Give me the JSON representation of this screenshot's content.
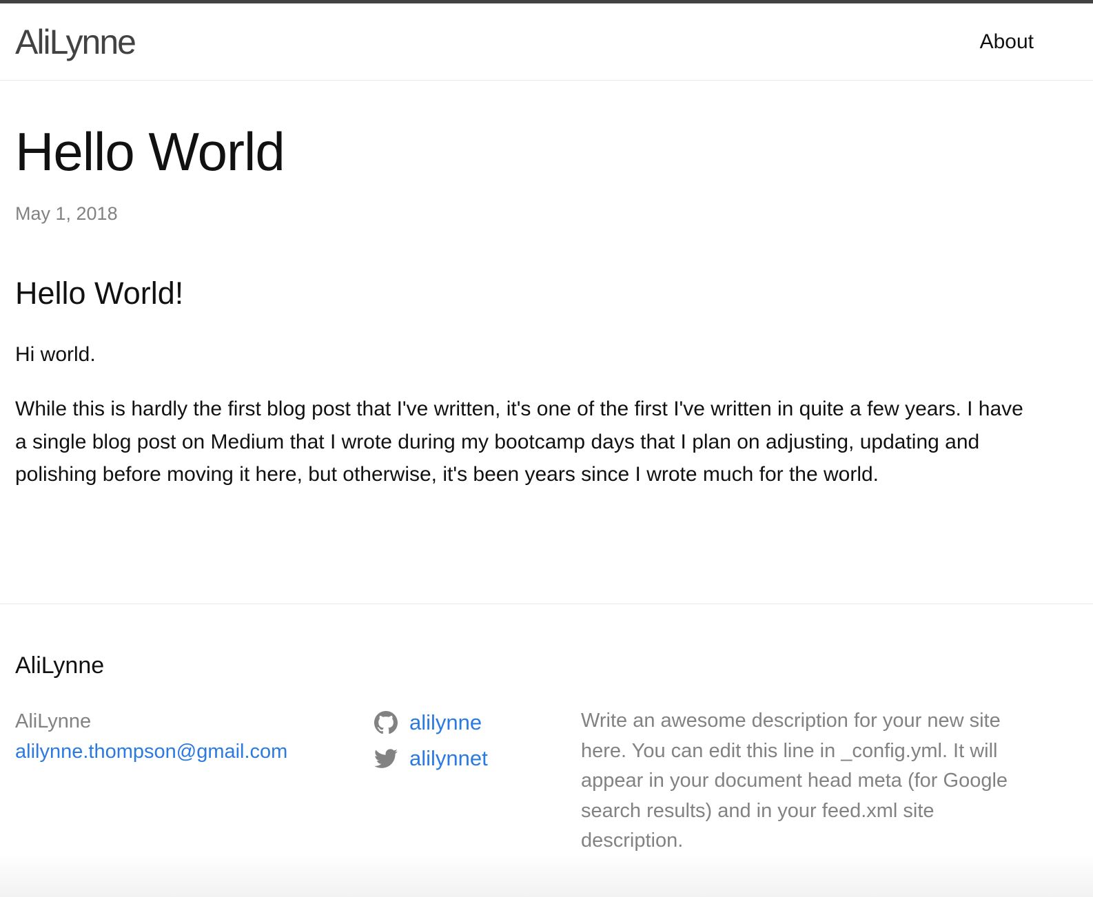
{
  "header": {
    "site_title": "AliLynne",
    "nav": {
      "about": "About"
    }
  },
  "post": {
    "title": "Hello World",
    "date": "May 1, 2018",
    "heading": "Hello World!",
    "paragraphs": [
      "Hi world.",
      "While this is hardly the first blog post that I've written, it's one of the first I've written in quite a few years. I have a single blog post on Medium that I wrote during my bootcamp days that I plan on adjusting, updating and polishing before moving it here, but otherwise, it's been years since I wrote much for the world."
    ]
  },
  "footer": {
    "heading": "AliLynne",
    "name": "AliLynne",
    "email": "alilynne.thompson@gmail.com",
    "social": [
      {
        "icon": "github-icon",
        "label": "alilynne"
      },
      {
        "icon": "twitter-icon",
        "label": "alilynnet"
      }
    ],
    "description": "Write an awesome description for your new site here. You can edit this line in _config.yml. It will appear in your document head meta (for Google search results) and in your feed.xml site description."
  },
  "colors": {
    "accent": "#2a7ae2",
    "muted_text": "#828282",
    "text": "#111111",
    "top_rule": "#424242",
    "divider": "#e8e8e8"
  }
}
